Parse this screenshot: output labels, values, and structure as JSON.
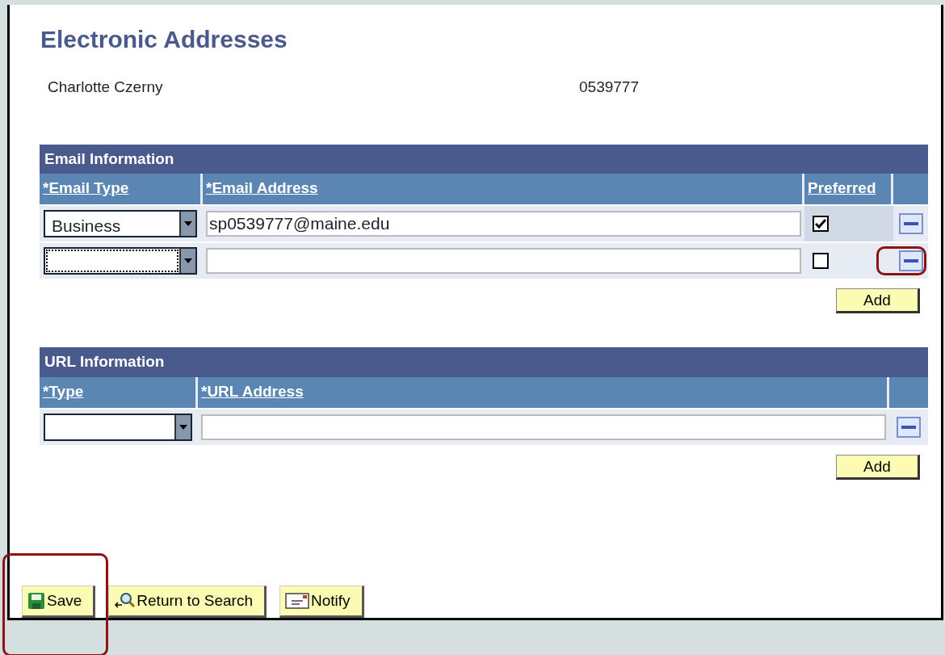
{
  "title": "Electronic Addresses",
  "person": {
    "name": "Charlotte Czerny",
    "id": "0539777"
  },
  "email": {
    "heading": "Email Information",
    "columns": [
      "*Email Type",
      "*Email Address",
      "Preferred"
    ],
    "rows": [
      {
        "type": "Business",
        "address": "sp0539777@maine.edu",
        "preferred": true,
        "focused": false,
        "highlighted": false
      },
      {
        "preferred": false,
        "focused": true,
        "highlighted": true
      }
    ],
    "add": "Add"
  },
  "url": {
    "heading": "URL Information",
    "columns": [
      "*Type",
      "*URL Address"
    ],
    "rows": [
      {
        "highlighted": false
      }
    ],
    "add": "Add"
  },
  "toolbar": [
    {
      "kind": "save",
      "label": "Save",
      "highlighted": true
    },
    {
      "kind": "search",
      "label": "Return to Search",
      "highlighted": false
    },
    {
      "kind": "notify",
      "label": "Notify",
      "highlighted": false
    }
  ]
}
